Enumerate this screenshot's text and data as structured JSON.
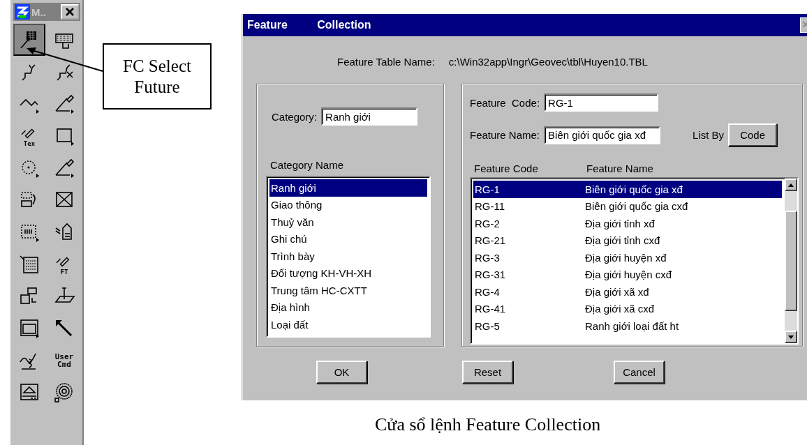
{
  "palette": {
    "title": "M..",
    "tools": [
      {
        "kind": "grid-select",
        "selected": true
      },
      {
        "kind": "keyboard",
        "selected": false
      },
      {
        "kind": "squiggle",
        "selected": false
      },
      {
        "kind": "squiggle-cut",
        "selected": false
      },
      {
        "kind": "polyline",
        "selected": false
      },
      {
        "kind": "angle-pen",
        "selected": false
      },
      {
        "kind": "text-pen",
        "label": "Tex",
        "selected": false
      },
      {
        "kind": "rectangle",
        "selected": false
      },
      {
        "kind": "circle",
        "selected": false
      },
      {
        "kind": "angle-pen",
        "selected": false
      },
      {
        "kind": "move-area",
        "selected": false
      },
      {
        "kind": "cross-box",
        "selected": false
      },
      {
        "kind": "fence",
        "selected": false
      },
      {
        "kind": "tag",
        "selected": false
      },
      {
        "kind": "table",
        "selected": false
      },
      {
        "kind": "text-pen",
        "label": "FT",
        "selected": false
      },
      {
        "kind": "stack",
        "selected": false
      },
      {
        "kind": "plane",
        "selected": false
      },
      {
        "kind": "window",
        "selected": false
      },
      {
        "kind": "arrow",
        "selected": false
      },
      {
        "kind": "curve",
        "selected": false
      },
      {
        "kind": "label",
        "label": "User Cmd",
        "selected": false
      },
      {
        "kind": "monitor",
        "selected": false
      },
      {
        "kind": "rings",
        "selected": false
      }
    ]
  },
  "callout": {
    "text": "FC Select Future"
  },
  "dialog": {
    "title": "Feature Collection",
    "table_name_label": "Feature Table Name:",
    "table_name": "c:\\Win32app\\Ingr\\Geovec\\tbl\\Huyen10.TBL",
    "category": {
      "label": "Category:",
      "value": "Ranh giới"
    },
    "category_list": {
      "heading": "Category Name",
      "items": [
        {
          "label": "Ranh giới",
          "selected": true
        },
        {
          "label": "Giao thông",
          "selected": false
        },
        {
          "label": "Thuỷ văn",
          "selected": false
        },
        {
          "label": "Ghi chú",
          "selected": false
        },
        {
          "label": "Trình bày",
          "selected": false
        },
        {
          "label": "Đối tượng KH-VH-XH",
          "selected": false
        },
        {
          "label": "Trung tâm HC-CXTT",
          "selected": false
        },
        {
          "label": "Địa hình",
          "selected": false
        },
        {
          "label": "Loại đất",
          "selected": false
        }
      ]
    },
    "feature_code": {
      "label": "Feature  Code:",
      "value": "RG-1"
    },
    "feature_name": {
      "label": "Feature Name:",
      "value": "Biên giới quốc gia xđ"
    },
    "list_by": {
      "label": "List By",
      "button": "Code"
    },
    "feature_table": {
      "columns": [
        "Feature Code",
        "Feature Name"
      ],
      "rows": [
        {
          "code": "RG-1",
          "name": "Biên giới quốc gia xđ",
          "selected": true
        },
        {
          "code": "RG-11",
          "name": "Biên giới quốc gia cxđ",
          "selected": false
        },
        {
          "code": "RG-2",
          "name": "Địa giới tỉnh xđ",
          "selected": false
        },
        {
          "code": "RG-21",
          "name": "Địa giới tỉnh cxđ",
          "selected": false
        },
        {
          "code": "RG-3",
          "name": "Địa giới huyện xđ",
          "selected": false
        },
        {
          "code": "RG-31",
          "name": "Địa giới huyện cxđ",
          "selected": false
        },
        {
          "code": "RG-4",
          "name": "Địa giới xã xđ",
          "selected": false
        },
        {
          "code": "RG-41",
          "name": "Địa giới xã cxđ",
          "selected": false
        },
        {
          "code": "RG-5",
          "name": "Ranh giới loại đất ht",
          "selected": false
        }
      ]
    },
    "buttons": [
      "OK",
      "Reset",
      "Cancel"
    ]
  },
  "caption": "Cửa sổ lệnh Feature Collection"
}
